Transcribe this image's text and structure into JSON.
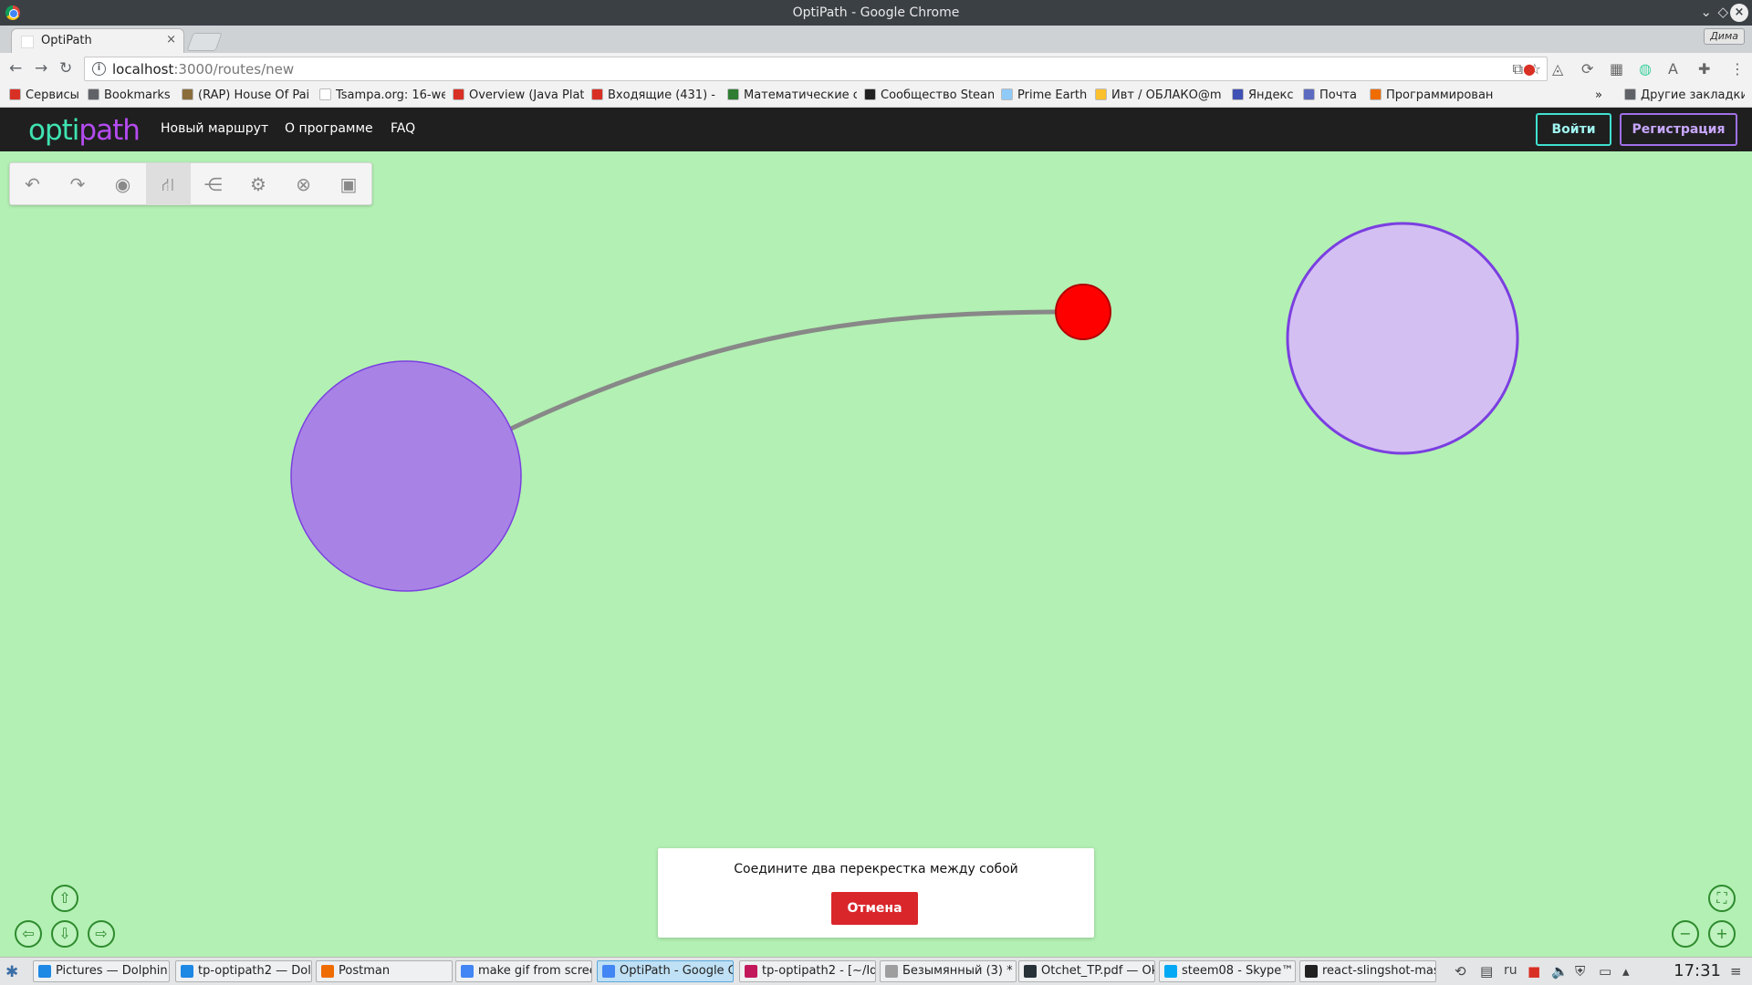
{
  "window": {
    "title": "OptiPath - Google Chrome"
  },
  "tab": {
    "title": "OptiPath",
    "close": "×"
  },
  "profile": {
    "label": "Дима"
  },
  "omnibox": {
    "host": "localhost",
    "path": ":3000/routes/new"
  },
  "bookmarks": [
    {
      "label": "Сервисы",
      "color": "#d93025"
    },
    {
      "label": "Bookmarks",
      "color": "#5f6368"
    },
    {
      "label": "(RAP) House Of Pai",
      "color": "#8a6d3b"
    },
    {
      "label": "Tsampa.org: 16-we",
      "color": "#ffffff"
    },
    {
      "label": "Overview (Java Plat",
      "color": "#d93025"
    },
    {
      "label": "Входящие (431) - e",
      "color": "#d93025"
    },
    {
      "label": "Математические с",
      "color": "#2e7d32"
    },
    {
      "label": "Сообщество Stean",
      "color": "#222222"
    },
    {
      "label": "Prime Earth",
      "color": "#90caf9"
    },
    {
      "label": "Ивт / ОБЛАКО@m",
      "color": "#fbc02d"
    },
    {
      "label": "Яндекс",
      "color": "#3f51b5"
    },
    {
      "label": "Почта",
      "color": "#5c6bc0"
    },
    {
      "label": "Программирован",
      "color": "#ef6c00"
    },
    {
      "label": "»",
      "color": ""
    },
    {
      "label": "Другие закладки",
      "color": "#5f6368"
    }
  ],
  "navbar": {
    "logo_part1": "opti",
    "logo_part2": "path",
    "links": [
      "Новый маршрут",
      "О программе",
      "FAQ"
    ],
    "login": "Войти",
    "register": "Регистрация"
  },
  "colors": {
    "canvas_bg": "#b3f0b3",
    "node_filled": "#a982e6",
    "node_light": "#d4bff2",
    "node_stroke": "#7a3fe0",
    "point": "#ff0000",
    "edge": "#888888"
  },
  "editor_tools": [
    {
      "name": "undo-icon",
      "glyph": "↶",
      "active": false
    },
    {
      "name": "redo-icon",
      "glyph": "↷",
      "active": false
    },
    {
      "name": "node-icon",
      "glyph": "◉",
      "active": false
    },
    {
      "name": "road-icon",
      "glyph": "⛙",
      "active": true
    },
    {
      "name": "share-icon",
      "glyph": "⋲",
      "active": false
    },
    {
      "name": "settings-icon",
      "glyph": "⚙",
      "active": false
    },
    {
      "name": "delete-icon",
      "glyph": "⊗",
      "active": false
    },
    {
      "name": "save-icon",
      "glyph": "▣",
      "active": false
    }
  ],
  "instruction": {
    "message": "Соедините два перекрестка между собой",
    "cancel": "Отмена"
  },
  "taskbar": {
    "tasks": [
      {
        "label": "Pictures — Dolphin",
        "color": "#1e88e5",
        "active": false
      },
      {
        "label": "tp-optipath2 — Dolp",
        "color": "#1e88e5",
        "active": false
      },
      {
        "label": "Postman",
        "color": "#ef6c00",
        "active": false
      },
      {
        "label": "make gif from scree",
        "color": "#4285f4",
        "active": false
      },
      {
        "label": "OptiPath - Google C",
        "color": "#4285f4",
        "active": true
      },
      {
        "label": "tp-optipath2 - [~/Ide",
        "color": "#c2185b",
        "active": false
      },
      {
        "label": "Безымянный (3) * -",
        "color": "#9e9e9e",
        "active": false
      },
      {
        "label": "Otchet_TP.pdf — Ok",
        "color": "#263238",
        "active": false
      },
      {
        "label": "steem08 - Skype™",
        "color": "#03a9f4",
        "active": false
      },
      {
        "label": "react-slingshot-mas",
        "color": "#212121",
        "active": false
      }
    ],
    "lang": "ru",
    "time": "17:31"
  }
}
